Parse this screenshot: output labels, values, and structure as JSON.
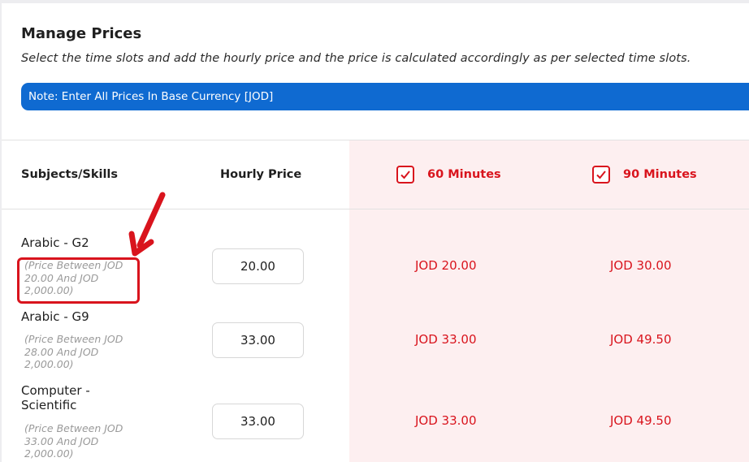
{
  "header": {
    "title": "Manage Prices",
    "subtitle": "Select the time slots and add the hourly price and the price is calculated accordingly as per selected time slots.",
    "note": "Note: Enter All Prices In Base Currency [JOD]"
  },
  "table": {
    "col_subject": "Subjects/Skills",
    "col_hourly": "Hourly Price",
    "slots": [
      {
        "label": "60 Minutes",
        "checked": true
      },
      {
        "label": "90 Minutes",
        "checked": true
      }
    ],
    "rows": [
      {
        "name": "Arabic - G2",
        "range": "(Price Between JOD 20.00 And JOD 2,000.00)",
        "hourly": "20.00",
        "price_60": "JOD 20.00",
        "price_90": "JOD 30.00"
      },
      {
        "name": "Arabic - G9",
        "range": "(Price Between JOD 28.00 And JOD 2,000.00)",
        "hourly": "33.00",
        "price_60": "JOD 33.00",
        "price_90": "JOD 49.50"
      },
      {
        "name": "Computer - Scientific",
        "range": "(Price Between JOD 33.00 And JOD 2,000.00)",
        "hourly": "33.00",
        "price_60": "JOD 33.00",
        "price_90": "JOD 49.50"
      }
    ]
  },
  "colors": {
    "accent_blue": "#0f6ad1",
    "accent_red": "#d9141d",
    "slot_bg": "#fdeff0"
  }
}
